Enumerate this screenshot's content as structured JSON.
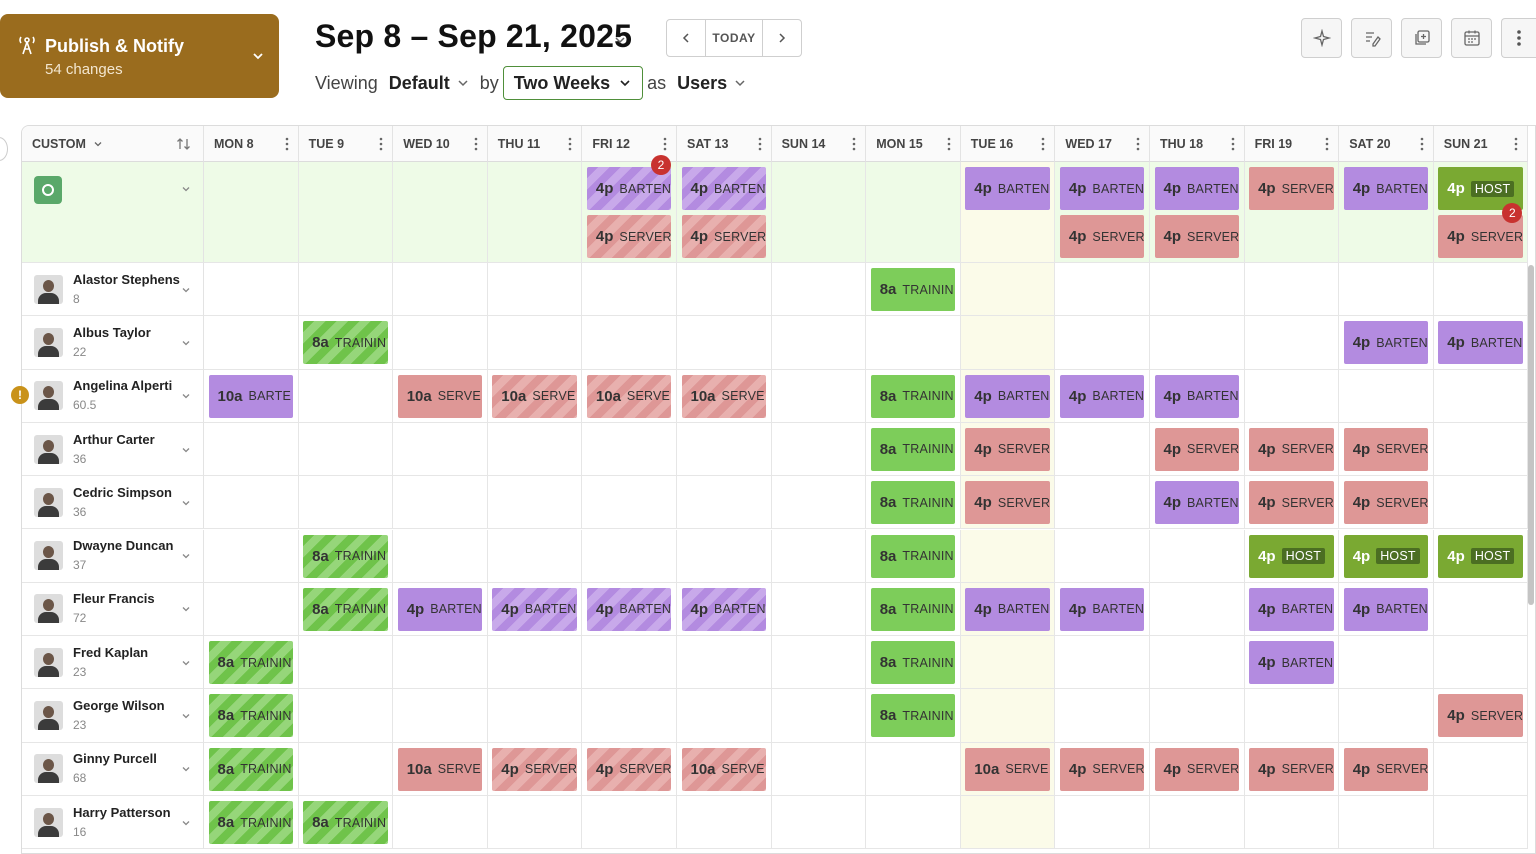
{
  "publish": {
    "title": "Publish & Notify",
    "subtitle": "54 changes"
  },
  "header": {
    "date_range": "Sep 8 – Sep 21, 2025",
    "today_label": "TODAY",
    "viewing_label": "Viewing",
    "viewing_value": "Default",
    "by_label": "by",
    "period_value": "Two Weeks",
    "as_label": "as",
    "as_value": "Users"
  },
  "toolbar": [
    "sparkle-icon",
    "edit-notes-icon",
    "copy-icon",
    "calendar-icon",
    "more-vertical-icon"
  ],
  "grid": {
    "sort_label": "CUSTOM",
    "days": [
      "MON 8",
      "TUE 9",
      "WED 10",
      "THU 11",
      "FRI 12",
      "SAT 13",
      "SUN 14",
      "MON 15",
      "TUE 16",
      "WED 17",
      "THU 18",
      "FRI 19",
      "SAT 20",
      "SUN 21"
    ],
    "today_index": 8,
    "open_shifts": [
      {
        "day": 4,
        "row": 0,
        "time": "4p",
        "role": "BARTEN",
        "color": "purple",
        "striped": true,
        "badge": "2"
      },
      {
        "day": 4,
        "row": 1,
        "time": "4p",
        "role": "SERVER",
        "color": "red",
        "striped": true
      },
      {
        "day": 5,
        "row": 0,
        "time": "4p",
        "role": "BARTEN",
        "color": "purple",
        "striped": true
      },
      {
        "day": 5,
        "row": 1,
        "time": "4p",
        "role": "SERVER",
        "color": "red",
        "striped": true
      },
      {
        "day": 8,
        "row": 0,
        "time": "4p",
        "role": "BARTEN",
        "color": "purple"
      },
      {
        "day": 9,
        "row": 0,
        "time": "4p",
        "role": "BARTEN",
        "color": "purple"
      },
      {
        "day": 9,
        "row": 1,
        "time": "4p",
        "role": "SERVER",
        "color": "red"
      },
      {
        "day": 10,
        "row": 0,
        "time": "4p",
        "role": "BARTEN",
        "color": "purple"
      },
      {
        "day": 10,
        "row": 1,
        "time": "4p",
        "role": "SERVER",
        "color": "red"
      },
      {
        "day": 11,
        "row": 0,
        "time": "4p",
        "role": "SERVER",
        "color": "red"
      },
      {
        "day": 12,
        "row": 0,
        "time": "4p",
        "role": "BARTEN",
        "color": "purple"
      },
      {
        "day": 13,
        "row": 0,
        "time": "4p",
        "role": "HOST",
        "color": "olive"
      },
      {
        "day": 13,
        "row": 1,
        "time": "4p",
        "role": "SERVER",
        "color": "red",
        "badge": "2"
      }
    ],
    "users": [
      {
        "name": "Alastor Stephens",
        "hours": "8",
        "shifts": [
          {
            "day": 7,
            "time": "8a",
            "role": "TRAININ",
            "color": "green"
          }
        ]
      },
      {
        "name": "Albus Taylor",
        "hours": "22",
        "shifts": [
          {
            "day": 1,
            "time": "8a",
            "role": "TRAININ",
            "color": "green",
            "striped": true
          },
          {
            "day": 12,
            "time": "4p",
            "role": "BARTEN",
            "color": "purple"
          },
          {
            "day": 13,
            "time": "4p",
            "role": "BARTEN",
            "color": "purple"
          }
        ]
      },
      {
        "name": "Angelina Alperti",
        "hours": "60.5",
        "warning": "!",
        "shifts": [
          {
            "day": 0,
            "time": "10a",
            "role": "BARTE",
            "color": "purple"
          },
          {
            "day": 2,
            "time": "10a",
            "role": "SERVE",
            "color": "red"
          },
          {
            "day": 3,
            "time": "10a",
            "role": "SERVE",
            "color": "red",
            "striped": true
          },
          {
            "day": 4,
            "time": "10a",
            "role": "SERVE",
            "color": "red",
            "striped": true
          },
          {
            "day": 5,
            "time": "10a",
            "role": "SERVE",
            "color": "red",
            "striped": true
          },
          {
            "day": 7,
            "time": "8a",
            "role": "TRAININ",
            "color": "green"
          },
          {
            "day": 8,
            "time": "4p",
            "role": "BARTEN",
            "color": "purple"
          },
          {
            "day": 9,
            "time": "4p",
            "role": "BARTEN",
            "color": "purple"
          },
          {
            "day": 10,
            "time": "4p",
            "role": "BARTEN",
            "color": "purple"
          }
        ]
      },
      {
        "name": "Arthur Carter",
        "hours": "36",
        "shifts": [
          {
            "day": 7,
            "time": "8a",
            "role": "TRAININ",
            "color": "green"
          },
          {
            "day": 8,
            "time": "4p",
            "role": "SERVER",
            "color": "red"
          },
          {
            "day": 10,
            "time": "4p",
            "role": "SERVER",
            "color": "red"
          },
          {
            "day": 11,
            "time": "4p",
            "role": "SERVER",
            "color": "red"
          },
          {
            "day": 12,
            "time": "4p",
            "role": "SERVER",
            "color": "red"
          }
        ]
      },
      {
        "name": "Cedric Simpson",
        "hours": "36",
        "shifts": [
          {
            "day": 7,
            "time": "8a",
            "role": "TRAININ",
            "color": "green"
          },
          {
            "day": 8,
            "time": "4p",
            "role": "SERVER",
            "color": "red"
          },
          {
            "day": 10,
            "time": "4p",
            "role": "BARTEN",
            "color": "purple"
          },
          {
            "day": 11,
            "time": "4p",
            "role": "SERVER",
            "color": "red"
          },
          {
            "day": 12,
            "time": "4p",
            "role": "SERVER",
            "color": "red"
          }
        ]
      },
      {
        "name": "Dwayne Duncan",
        "hours": "37",
        "shifts": [
          {
            "day": 1,
            "time": "8a",
            "role": "TRAININ",
            "color": "green",
            "striped": true
          },
          {
            "day": 7,
            "time": "8a",
            "role": "TRAININ",
            "color": "green"
          },
          {
            "day": 11,
            "time": "4p",
            "role": "HOST",
            "color": "olive"
          },
          {
            "day": 12,
            "time": "4p",
            "role": "HOST",
            "color": "olive"
          },
          {
            "day": 13,
            "time": "4p",
            "role": "HOST",
            "color": "olive"
          }
        ]
      },
      {
        "name": "Fleur Francis",
        "hours": "72",
        "shifts": [
          {
            "day": 1,
            "time": "8a",
            "role": "TRAININ",
            "color": "green",
            "striped": true
          },
          {
            "day": 2,
            "time": "4p",
            "role": "BARTEN",
            "color": "purple"
          },
          {
            "day": 3,
            "time": "4p",
            "role": "BARTEN",
            "color": "purple",
            "striped": true
          },
          {
            "day": 4,
            "time": "4p",
            "role": "BARTEN",
            "color": "purple",
            "striped": true
          },
          {
            "day": 5,
            "time": "4p",
            "role": "BARTEN",
            "color": "purple",
            "striped": true
          },
          {
            "day": 7,
            "time": "8a",
            "role": "TRAININ",
            "color": "green"
          },
          {
            "day": 8,
            "time": "4p",
            "role": "BARTEN",
            "color": "purple"
          },
          {
            "day": 9,
            "time": "4p",
            "role": "BARTEN",
            "color": "purple"
          },
          {
            "day": 11,
            "time": "4p",
            "role": "BARTEN",
            "color": "purple"
          },
          {
            "day": 12,
            "time": "4p",
            "role": "BARTEN",
            "color": "purple"
          }
        ]
      },
      {
        "name": "Fred Kaplan",
        "hours": "23",
        "shifts": [
          {
            "day": 0,
            "time": "8a",
            "role": "TRAININ",
            "color": "green",
            "striped": true
          },
          {
            "day": 7,
            "time": "8a",
            "role": "TRAININ",
            "color": "green"
          },
          {
            "day": 11,
            "time": "4p",
            "role": "BARTEN",
            "color": "purple"
          }
        ]
      },
      {
        "name": "George Wilson",
        "hours": "23",
        "shifts": [
          {
            "day": 0,
            "time": "8a",
            "role": "TRAININ",
            "color": "green",
            "striped": true
          },
          {
            "day": 7,
            "time": "8a",
            "role": "TRAININ",
            "color": "green"
          },
          {
            "day": 13,
            "time": "4p",
            "role": "SERVER",
            "color": "red"
          }
        ]
      },
      {
        "name": "Ginny Purcell",
        "hours": "68",
        "shifts": [
          {
            "day": 0,
            "time": "8a",
            "role": "TRAININ",
            "color": "green",
            "striped": true
          },
          {
            "day": 2,
            "time": "10a",
            "role": "SERVE",
            "color": "red"
          },
          {
            "day": 3,
            "time": "4p",
            "role": "SERVER",
            "color": "red",
            "striped": true
          },
          {
            "day": 4,
            "time": "4p",
            "role": "SERVER",
            "color": "red",
            "striped": true
          },
          {
            "day": 5,
            "time": "10a",
            "role": "SERVE",
            "color": "red",
            "striped": true
          },
          {
            "day": 8,
            "time": "10a",
            "role": "SERVE",
            "color": "red"
          },
          {
            "day": 9,
            "time": "4p",
            "role": "SERVER",
            "color": "red"
          },
          {
            "day": 10,
            "time": "4p",
            "role": "SERVER",
            "color": "red"
          },
          {
            "day": 11,
            "time": "4p",
            "role": "SERVER",
            "color": "red"
          },
          {
            "day": 12,
            "time": "4p",
            "role": "SERVER",
            "color": "red"
          }
        ]
      },
      {
        "name": "Harry Patterson",
        "hours": "16",
        "shifts": [
          {
            "day": 0,
            "time": "8a",
            "role": "TRAININ",
            "color": "green",
            "striped": true
          },
          {
            "day": 1,
            "time": "8a",
            "role": "TRAININ",
            "color": "green",
            "striped": true
          }
        ]
      }
    ]
  }
}
